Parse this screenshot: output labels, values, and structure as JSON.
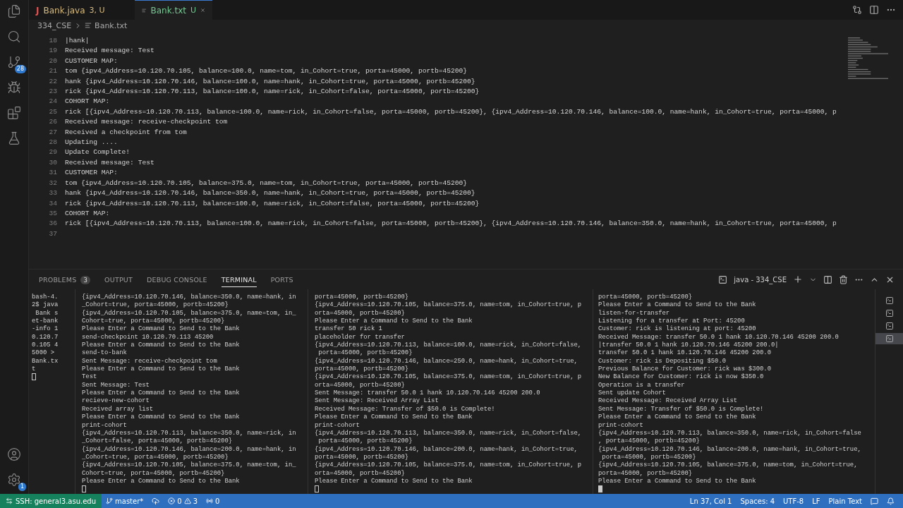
{
  "activity_bar": {
    "source_control_badge": "28",
    "manage_badge": "1"
  },
  "tabs": [
    {
      "icon": "J",
      "label": "Bank.java",
      "status": "3, U",
      "selected": false
    },
    {
      "label": "Bank.txt",
      "status": "U",
      "selected": true
    }
  ],
  "breadcrumb": [
    "334_CSE",
    "Bank.txt"
  ],
  "editor": {
    "lines": [
      {
        "number": "18",
        "text": "|hank|"
      },
      {
        "number": "19",
        "text": "Received message: Test"
      },
      {
        "number": "20",
        "text": "CUSTOMER MAP:"
      },
      {
        "number": "21",
        "text": "tom {ipv4_Address=10.120.70.105, balance=100.0, name=tom, in_Cohort=true, porta=45000, portb=45200}"
      },
      {
        "number": "22",
        "text": "hank {ipv4_Address=10.120.70.146, balance=100.0, name=hank, in_Cohort=true, porta=45000, portb=45200}"
      },
      {
        "number": "23",
        "text": "rick {ipv4_Address=10.120.70.113, balance=100.0, name=rick, in_Cohort=false, porta=45000, portb=45200}"
      },
      {
        "number": "24",
        "text": "COHORT MAP:"
      },
      {
        "number": "25",
        "text": "rick [{ipv4_Address=10.120.70.113, balance=100.0, name=rick, in_Cohort=false, porta=45000, portb=45200}, {ipv4_Address=10.120.70.146, balance=100.0, name=hank, in_Cohort=true, porta=45000, p"
      },
      {
        "number": "26",
        "text": "Received message: receive-checkpoint tom"
      },
      {
        "number": "27",
        "text": "Received a checkpoint from tom"
      },
      {
        "number": "28",
        "text": "Updating ...."
      },
      {
        "number": "29",
        "text": "Update Complete!"
      },
      {
        "number": "30",
        "text": "Received message: Test"
      },
      {
        "number": "31",
        "text": "CUSTOMER MAP:"
      },
      {
        "number": "32",
        "text": "tom {ipv4_Address=10.120.70.105, balance=375.0, name=tom, in_Cohort=true, porta=45000, portb=45200}"
      },
      {
        "number": "33",
        "text": "hank {ipv4_Address=10.120.70.146, balance=350.0, name=hank, in_Cohort=true, porta=45000, portb=45200}"
      },
      {
        "number": "34",
        "text": "rick {ipv4_Address=10.120.70.113, balance=100.0, name=rick, in_Cohort=false, porta=45000, portb=45200}"
      },
      {
        "number": "35",
        "text": "COHORT MAP:"
      },
      {
        "number": "36",
        "text": "rick [{ipv4_Address=10.120.70.113, balance=100.0, name=rick, in_Cohort=false, porta=45000, portb=45200}, {ipv4_Address=10.120.70.146, balance=350.0, name=hank, in_Cohort=true, porta=45000, p"
      },
      {
        "number": "37"
      }
    ]
  },
  "panel": {
    "tabs": [
      {
        "label": "PROBLEMS",
        "badge": "3",
        "selected": false
      },
      {
        "label": "OUTPUT",
        "selected": false
      },
      {
        "label": "DEBUG CONSOLE",
        "selected": false
      },
      {
        "label": "TERMINAL",
        "selected": true
      },
      {
        "label": "PORTS",
        "selected": false
      }
    ],
    "terminal_name": "java - 334_CSE",
    "terminals": [
      {
        "focused": false,
        "rows": [
          "bash-4.",
          "2$ java",
          " Bank s",
          "et-bank",
          "-info 1",
          "0.120.7",
          "0.105 4",
          "5000 >",
          "Bank.tx",
          "t"
        ]
      },
      {
        "focused": false,
        "rows": [
          "{ipv4_Address=10.120.70.146, balance=350.0, name=hank, in",
          "_Cohort=true, porta=45000, portb=45200}",
          "{ipv4_Address=10.120.70.105, balance=375.0, name=tom, in_",
          "Cohort=true, porta=45000, portb=45200}",
          "Please Enter a Command to Send to the Bank",
          "send-checkpoint 10.120.70.113 45200",
          "Please Enter a Command to Send to the Bank",
          "send-to-bank",
          "Sent Message: receive-checkpoint tom",
          "Please Enter a Command to Send to the Bank",
          "Test",
          "Sent Message: Test",
          "Please Enter a Command to Send to the Bank",
          "recieve-new-cohort",
          "Received array list",
          "Please Enter a Command to Send to the Bank",
          "print-cohort",
          "{ipv4_Address=10.120.70.113, balance=350.0, name=rick, in",
          "_Cohort=false, porta=45000, portb=45200}",
          "{ipv4_Address=10.120.70.146, balance=200.0, name=hank, in",
          "_Cohort=true, porta=45000, portb=45200}",
          "{ipv4_Address=10.120.70.105, balance=375.0, name=tom, in_",
          "Cohort=true, porta=45000, portb=45200}",
          "Please Enter a Command to Send to the Bank"
        ]
      },
      {
        "focused": false,
        "rows": [
          "porta=45000, portb=45200}",
          "{ipv4_Address=10.120.70.105, balance=375.0, name=tom, in_Cohort=true, p",
          "orta=45000, portb=45200}",
          "Please Enter a Command to Send to the Bank",
          "transfer 50 rick 1",
          "placeholder for transfer",
          "{ipv4_Address=10.120.70.113, balance=100.0, name=rick, in_Cohort=false,",
          " porta=45000, portb=45200}",
          "{ipv4_Address=10.120.70.146, balance=250.0, name=hank, in_Cohort=true,",
          "porta=45000, portb=45200}",
          "{ipv4_Address=10.120.70.105, balance=375.0, name=tom, in_Cohort=true, p",
          "orta=45000, portb=45200}",
          "Sent Message: transfer 50.0 1 hank 10.120.70.146 45200 200.0",
          "Sent Message: Received Array List",
          "Received Message: Transfer of $50.0 is Complete!",
          "Please Enter a Command to Send to the Bank",
          "print-cohort",
          "{ipv4_Address=10.120.70.113, balance=350.0, name=rick, in_Cohort=false,",
          " porta=45000, portb=45200}",
          "{ipv4_Address=10.120.70.146, balance=200.0, name=hank, in_Cohort=true,",
          "porta=45000, portb=45200}",
          "{ipv4_Address=10.120.70.105, balance=375.0, name=tom, in_Cohort=true, p",
          "orta=45000, portb=45200}",
          "Please Enter a Command to Send to the Bank"
        ]
      },
      {
        "focused": true,
        "rows": [
          "porta=45000, portb=45200}",
          "Please Enter a Command to Send to the Bank",
          "listen-for-transfer",
          "Listening for a transfer at Port: 45200",
          "Customer: rick is listening at port: 45200",
          "Received Message: transfer 50.0 1 hank 10.120.70.146 45200 200.0",
          "|transfer 50.0 1 hank 10.120.70.146 45200 200.0|",
          "transfer 50.0 1 hank 10.120.70.146 45200 200.0",
          "Customer: rick is Depositing $50.0",
          "Previous Balance for Customer: rick was $300.0",
          "New Balance for Customer: rick is now $350.0",
          "Operation is a transfer",
          "Sent update Cohort",
          "Received Message: Received Array List",
          "Sent Message: Transfer of $50.0 is Complete!",
          "Please Enter a Command to Send to the Bank",
          "print-cohort",
          "{ipv4_Address=10.120.70.113, balance=350.0, name=rick, in_Cohort=false",
          ", porta=45000, portb=45200}",
          "{ipv4_Address=10.120.70.146, balance=200.0, name=hank, in_Cohort=true,",
          " porta=45000, portb=45200}",
          "{ipv4_Address=10.120.70.105, balance=375.0, name=tom, in_Cohort=true,",
          "porta=45000, portb=45200}",
          "Please Enter a Command to Send to the Bank"
        ]
      }
    ],
    "terminal_list": [
      {
        "selected": false
      },
      {
        "selected": false
      },
      {
        "selected": false
      },
      {
        "selected": true
      }
    ]
  },
  "status_bar": {
    "remote": "SSH: general3.asu.edu",
    "branch": "master*",
    "errors": "0",
    "warnings": "3",
    "ports": "0",
    "right": [
      "Ln 37, Col 1",
      "Spaces: 4",
      "UTF-8",
      "LF",
      "Plain Text"
    ]
  }
}
